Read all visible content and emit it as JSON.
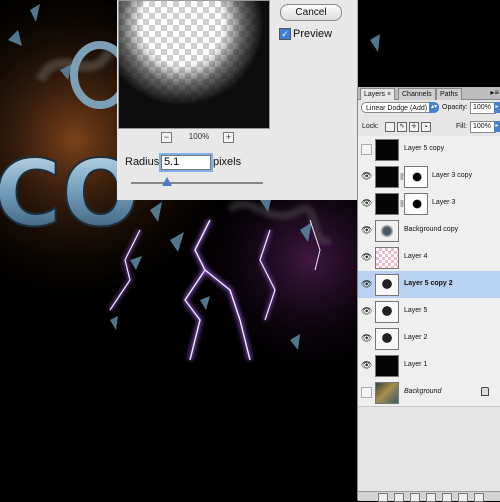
{
  "dialog": {
    "cancel_label": "Cancel",
    "preview_label": "Preview",
    "preview_checked": true,
    "zoom_minus": "−",
    "zoom_plus": "+",
    "zoom_level": "100%",
    "radius_label": "Radius:",
    "radius_value": "5.1",
    "radius_unit": "pixels"
  },
  "layers_panel": {
    "tabs": [
      {
        "label": "Layers",
        "active": true,
        "close": "×"
      },
      {
        "label": "Channels",
        "active": false
      },
      {
        "label": "Paths",
        "active": false
      }
    ],
    "menu_icon": "panel-menu-icon",
    "blend_mode": "Linear Dodge (Add)",
    "opacity_label": "Opacity:",
    "opacity_value": "100%",
    "lock_label": "Lock:",
    "fill_label": "Fill:",
    "fill_value": "100%",
    "layers": [
      {
        "name": "Layer 5 copy",
        "visible": false,
        "thumb": "black",
        "selected": false
      },
      {
        "name": "Layer 3 copy",
        "visible": true,
        "thumb": "black",
        "mask": true,
        "selected": false
      },
      {
        "name": "Layer 3",
        "visible": true,
        "thumb": "black",
        "mask": true,
        "selected": false
      },
      {
        "name": "Background copy",
        "visible": true,
        "thumb": "smoke",
        "selected": false
      },
      {
        "name": "Layer 4",
        "visible": true,
        "thumb": "check",
        "selected": false
      },
      {
        "name": "Layer 5 copy 2",
        "visible": true,
        "thumb": "mixed",
        "selected": true
      },
      {
        "name": "Layer 5",
        "visible": true,
        "thumb": "mixed",
        "selected": false
      },
      {
        "name": "Layer 2",
        "visible": true,
        "thumb": "mixed",
        "selected": false
      },
      {
        "name": "Layer 1",
        "visible": true,
        "thumb": "black",
        "selected": false
      },
      {
        "name": "Background",
        "visible": false,
        "thumb": "bg",
        "locked": true,
        "selected": false
      }
    ]
  },
  "canvas": {
    "text_fragment": "CO",
    "accent_lightning": "#f1dcff",
    "accent_glow": "#9a3dff"
  }
}
